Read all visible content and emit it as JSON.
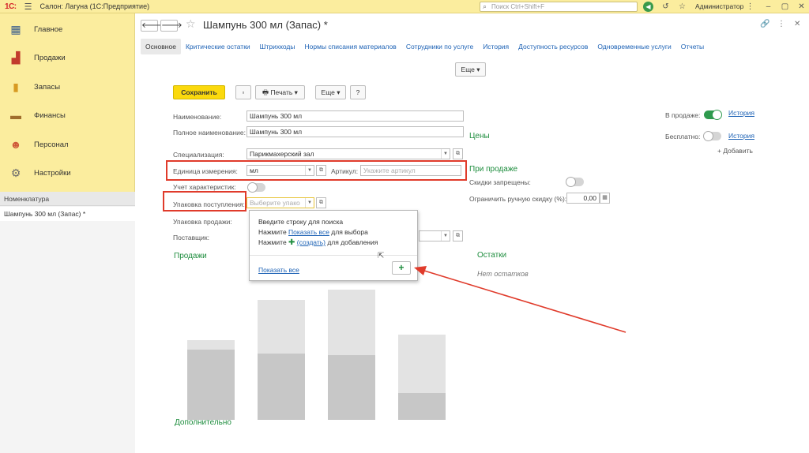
{
  "app": {
    "logo": "1С:",
    "title": "Салон: Лагуна  (1С:Предприятие)",
    "search_placeholder": "Поиск Ctrl+Shift+F",
    "user": "Администратор"
  },
  "sidebar": {
    "items": [
      {
        "label": "Главное",
        "icon": "building-icon",
        "color": "#3b5e8c"
      },
      {
        "label": "Продажи",
        "icon": "chart-icon",
        "color": "#c23b2d"
      },
      {
        "label": "Запасы",
        "icon": "bottles-icon",
        "color": "#d79a22"
      },
      {
        "label": "Финансы",
        "icon": "wallet-icon",
        "color": "#a06e2c"
      },
      {
        "label": "Персонал",
        "icon": "people-icon",
        "color": "#cf5a3a"
      },
      {
        "label": "Настройки",
        "icon": "gear-icon",
        "color": "#6b6b6b"
      }
    ],
    "nav_header": "Номенклатура",
    "nav_item": "Шампунь 300 мл (Запас) *"
  },
  "doc": {
    "title": "Шампунь 300 мл (Запас) *",
    "tabs": [
      "Основное",
      "Критические остатки",
      "Штрихкоды",
      "Нормы списания материалов",
      "Сотрудники по услуге",
      "История",
      "Доступность ресурсов",
      "Одновременные услуги",
      "Отчеты"
    ],
    "more_label": "Еще",
    "save_label": "Сохранить",
    "print_label": "Печать",
    "more2_label": "Еще",
    "help_label": "?"
  },
  "form": {
    "name_label": "Наименование:",
    "name_value": "Шампунь 300 мл",
    "full_name_label": "Полное наименование:",
    "full_name_value": "Шампунь 300 мл",
    "spec_label": "Специализация:",
    "spec_value": "Парикмахерский зал",
    "unit_label": "Единица измерения:",
    "unit_value": "мл",
    "article_label": "Артикул:",
    "article_placeholder": "Укажите артикул",
    "char_label": "Учет характеристик:",
    "pack_in_label": "Упаковка поступления:",
    "pack_in_placeholder": "Выберите упако",
    "pack_out_label": "Упаковка продажи:",
    "supplier_label": "Поставщик:"
  },
  "popup": {
    "line1": "Введите строку для поиска",
    "line2_pre": "Нажмите ",
    "line2_link": "Показать все",
    "line2_post": " для выбора",
    "line3_pre": "Нажмите ",
    "line3_link": "(создать)",
    "line3_post": " для добавления",
    "show_all": "Показать все",
    "plus": "+"
  },
  "right": {
    "on_sale_label": "В продаже:",
    "history1": "История",
    "free_label": "Бесплатно:",
    "history2": "История",
    "add_label": "+ Добавить",
    "prices_head": "Цены",
    "on_sale_head": "При продаже",
    "discount_forbidden": "Скидки запрещены:",
    "manual_discount": "Ограничить ручную скидку (%):",
    "manual_discount_value": "0,00"
  },
  "sections": {
    "sales": "Продажи",
    "stock": "Остатки",
    "no_stock": "Нет остатков",
    "extra": "Дополнительно"
  }
}
